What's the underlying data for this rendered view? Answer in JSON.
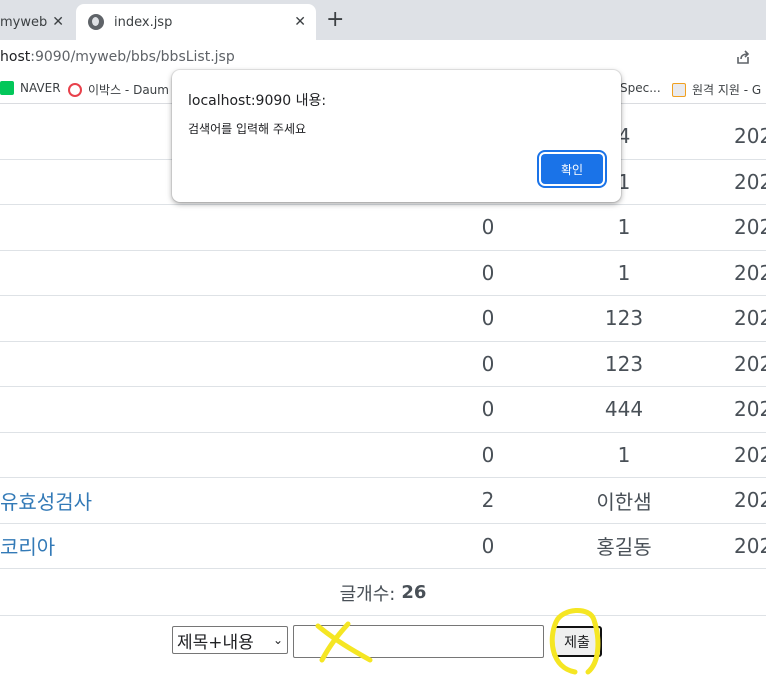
{
  "browser": {
    "tabs": [
      {
        "title": "myweb",
        "close": "✕"
      },
      {
        "title": "index.jsp",
        "close": "✕"
      }
    ],
    "new_tab": "+",
    "url_host": "host",
    "url_path": ":9090/myweb/bbs/bbsList.jsp",
    "bookmarks": [
      {
        "label": "NAVER"
      },
      {
        "label": "이박스 - Daum"
      },
      {
        "label": "Spec..."
      },
      {
        "label": "원격 지원 - G"
      }
    ]
  },
  "dialog": {
    "title": "localhost:9090 내용:",
    "message": "검색어를 입력해 주세요",
    "ok_label": "확인"
  },
  "table": {
    "rows": [
      {
        "subject": "",
        "readcnt": "",
        "writer": "4",
        "date": "202"
      },
      {
        "subject": "",
        "readcnt": "",
        "writer": "1",
        "date": "202"
      },
      {
        "subject": "",
        "readcnt": "0",
        "writer": "1",
        "date": "202"
      },
      {
        "subject": "",
        "readcnt": "0",
        "writer": "1",
        "date": "202"
      },
      {
        "subject": "",
        "readcnt": "0",
        "writer": "123",
        "date": "202"
      },
      {
        "subject": "",
        "readcnt": "0",
        "writer": "123",
        "date": "202"
      },
      {
        "subject": "",
        "readcnt": "0",
        "writer": "444",
        "date": "202"
      },
      {
        "subject": "",
        "readcnt": "0",
        "writer": "1",
        "date": "202"
      },
      {
        "subject": "유효성검사",
        "readcnt": "2",
        "writer": "이한샘",
        "date": "202"
      },
      {
        "subject": "코리아",
        "readcnt": "0",
        "writer": "홍길동",
        "date": "202"
      }
    ],
    "count_label": "글개수:",
    "count_value": "26"
  },
  "search": {
    "column_selected": "제목+내용",
    "word_value": "",
    "submit_label": "제출"
  },
  "colors": {
    "link": "#337ab7",
    "dialog_button": "#1a73e8",
    "highlight_marker": "#f5e623"
  }
}
